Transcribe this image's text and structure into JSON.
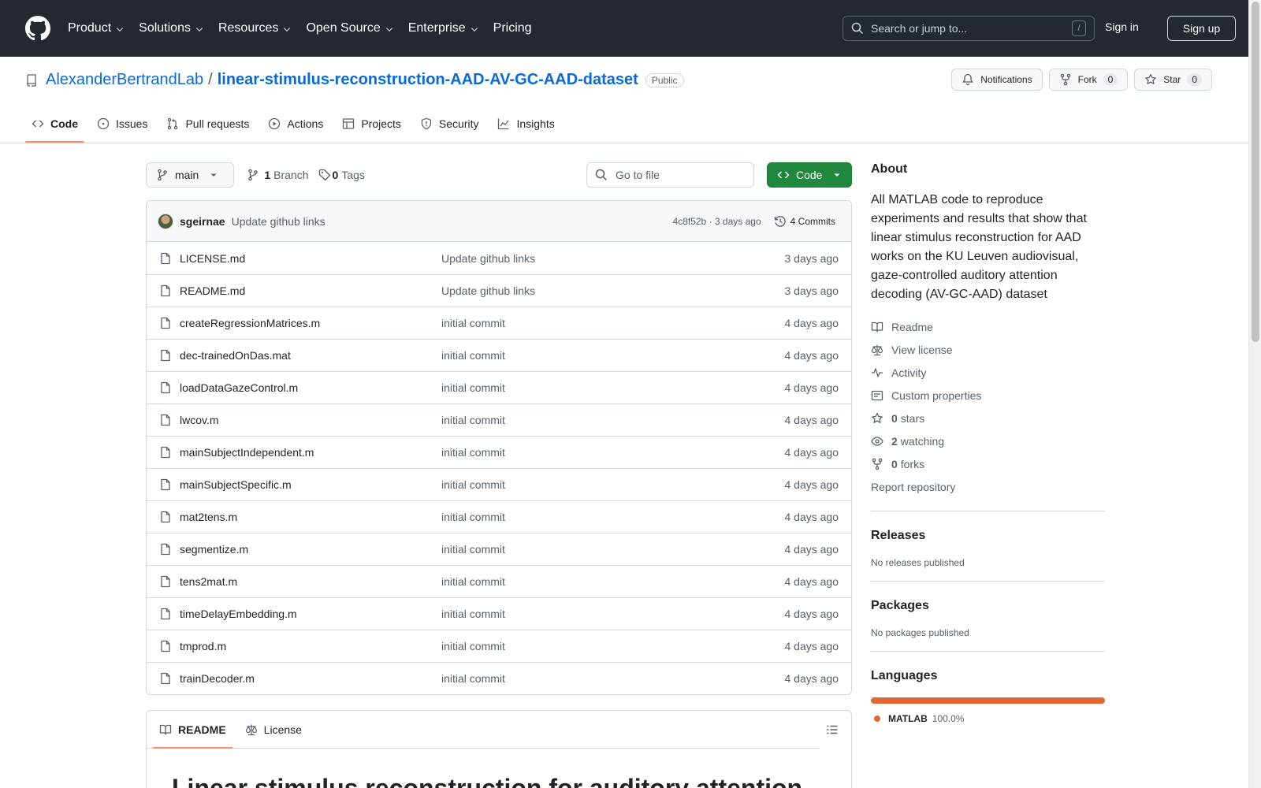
{
  "header": {
    "nav": [
      {
        "label": "Product",
        "dropdown": true
      },
      {
        "label": "Solutions",
        "dropdown": true
      },
      {
        "label": "Resources",
        "dropdown": true
      },
      {
        "label": "Open Source",
        "dropdown": true
      },
      {
        "label": "Enterprise",
        "dropdown": true
      },
      {
        "label": "Pricing",
        "dropdown": false
      }
    ],
    "search_placeholder": "Search or jump to...",
    "search_shortcut": "/",
    "sign_in": "Sign in",
    "sign_up": "Sign up"
  },
  "repo": {
    "owner": "AlexanderBertrandLab",
    "separator": "/",
    "name": "linear-stimulus-reconstruction-AAD-AV-GC-AAD-dataset",
    "visibility": "Public",
    "actions": {
      "notifications": "Notifications",
      "fork": "Fork",
      "fork_count": "0",
      "star": "Star",
      "star_count": "0"
    },
    "tabs": [
      {
        "label": "Code",
        "icon": "code-icon",
        "active": true
      },
      {
        "label": "Issues",
        "icon": "issue-icon",
        "active": false
      },
      {
        "label": "Pull requests",
        "icon": "pull-request-icon",
        "active": false
      },
      {
        "label": "Actions",
        "icon": "play-icon",
        "active": false
      },
      {
        "label": "Projects",
        "icon": "table-icon",
        "active": false
      },
      {
        "label": "Security",
        "icon": "shield-icon",
        "active": false
      },
      {
        "label": "Insights",
        "icon": "graph-icon",
        "active": false
      }
    ]
  },
  "browser": {
    "branch": "main",
    "branch_count": "1",
    "branch_label": "Branch",
    "tag_count": "0",
    "tag_label": "Tags",
    "go_to_file": "Go to file",
    "code_button": "Code",
    "latest_commit": {
      "author": "sgeirnae",
      "message": "Update github links",
      "sha": "4c8f52b",
      "dot": "·",
      "age": "3 days ago",
      "commits_count": "4",
      "commits_label": "Commits"
    },
    "files": [
      {
        "name": "LICENSE.md",
        "message": "Update github links",
        "age": "3 days ago"
      },
      {
        "name": "README.md",
        "message": "Update github links",
        "age": "3 days ago"
      },
      {
        "name": "createRegressionMatrices.m",
        "message": "initial commit",
        "age": "4 days ago"
      },
      {
        "name": "dec-trainedOnDas.mat",
        "message": "initial commit",
        "age": "4 days ago"
      },
      {
        "name": "loadDataGazeControl.m",
        "message": "initial commit",
        "age": "4 days ago"
      },
      {
        "name": "lwcov.m",
        "message": "initial commit",
        "age": "4 days ago"
      },
      {
        "name": "mainSubjectIndependent.m",
        "message": "initial commit",
        "age": "4 days ago"
      },
      {
        "name": "mainSubjectSpecific.m",
        "message": "initial commit",
        "age": "4 days ago"
      },
      {
        "name": "mat2tens.m",
        "message": "initial commit",
        "age": "4 days ago"
      },
      {
        "name": "segmentize.m",
        "message": "initial commit",
        "age": "4 days ago"
      },
      {
        "name": "tens2mat.m",
        "message": "initial commit",
        "age": "4 days ago"
      },
      {
        "name": "timeDelayEmbedding.m",
        "message": "initial commit",
        "age": "4 days ago"
      },
      {
        "name": "tmprod.m",
        "message": "initial commit",
        "age": "4 days ago"
      },
      {
        "name": "trainDecoder.m",
        "message": "initial commit",
        "age": "4 days ago"
      }
    ]
  },
  "readme": {
    "tab_readme": "README",
    "tab_license": "License",
    "heading": "Linear stimulus reconstruction for auditory attention"
  },
  "sidebar": {
    "about_title": "About",
    "description": "All MATLAB code to reproduce experiments and results that show that linear stimulus reconstruction for AAD works on the KU Leuven audiovisual, gaze-controlled auditory attention decoding (AV-GC-AAD) dataset",
    "links": {
      "readme": "Readme",
      "license": "View license",
      "activity": "Activity",
      "custom_properties": "Custom properties",
      "stars_count": "0",
      "stars_label": "stars",
      "watching_count": "2",
      "watching_label": "watching",
      "forks_count": "0",
      "forks_label": "forks",
      "report": "Report repository"
    },
    "releases_title": "Releases",
    "releases_sub": "No releases published",
    "packages_title": "Packages",
    "packages_sub": "No packages published",
    "languages_title": "Languages",
    "languages": [
      {
        "name": "MATLAB",
        "percent": "100.0%",
        "color": "#e16737"
      }
    ]
  },
  "colors": {
    "header_bg": "#24292f",
    "link": "#0969da",
    "code_button": "#1f883d",
    "active_tab_underline": "#fd8c73"
  }
}
